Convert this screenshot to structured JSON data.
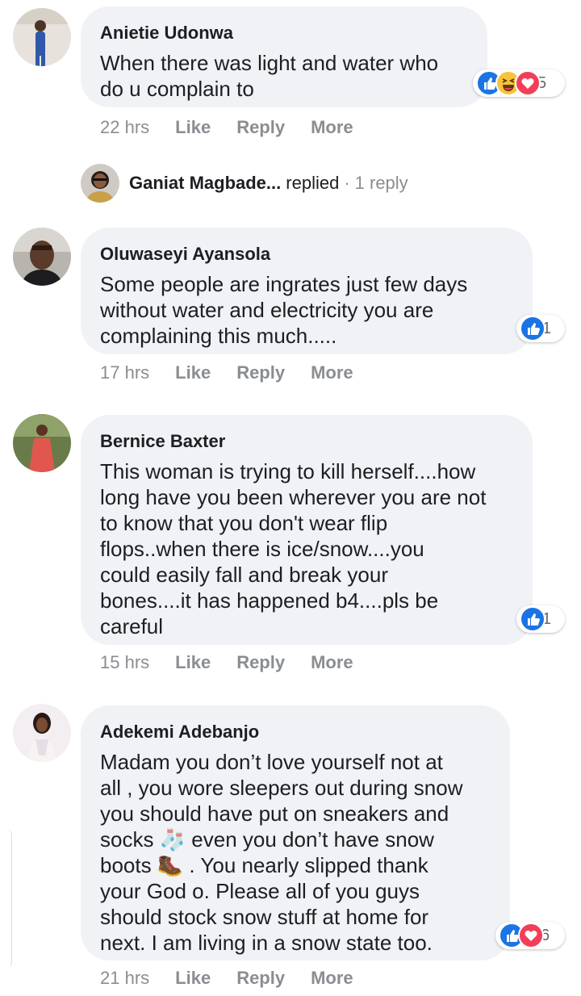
{
  "comments": [
    {
      "name": "Anietie Udonwa",
      "text": "When there was light and water who\ndo u complain to",
      "time": "22 hrs",
      "like": "Like",
      "reply": "Reply",
      "more": "More",
      "reaction_count": "5",
      "reactions": [
        "like",
        "haha",
        "love"
      ]
    },
    {
      "name": "Oluwaseyi Ayansola",
      "text": "Some people are ingrates just few days\nwithout water and electricity you are\ncomplaining this much.....",
      "time": "17 hrs",
      "like": "Like",
      "reply": "Reply",
      "more": "More",
      "reaction_count": "1",
      "reactions": [
        "like"
      ]
    },
    {
      "name": "Bernice Baxter",
      "text": "This woman is trying to kill herself....how\nlong have you been wherever you are not\nto know that you don't wear flip\nflops..when there is ice/snow....you\ncould easily fall and break your\nbones....it has happened b4....pls be\ncareful",
      "time": "15 hrs",
      "like": "Like",
      "reply": "Reply",
      "more": "More",
      "reaction_count": "1",
      "reactions": [
        "like"
      ]
    },
    {
      "name": "Adekemi Adebanjo",
      "text": "Madam you don’t love yourself not at\nall , you wore sleepers out during snow\nyou should have put on sneakers and\nsocks 🧦 even you don’t have snow\nboots 🥾 . You nearly slipped thank\nyour God o. Please all of you guys\nshould stock snow stuff at home for\nnext. I am living in a snow state too.",
      "time": "21 hrs",
      "like": "Like",
      "reply": "Reply",
      "more": "More",
      "reaction_count": "6",
      "reactions": [
        "like",
        "love"
      ]
    }
  ],
  "reply_thread": {
    "name": "Ganiat Magbade...",
    "action": "replied",
    "separator": "·",
    "count": "1 reply"
  },
  "colors": {
    "bubble": "#f0f2f5",
    "meta": "#8a8d91",
    "like": "#1b74e4",
    "love": "#f33e58",
    "haha": "#f7c33c"
  }
}
